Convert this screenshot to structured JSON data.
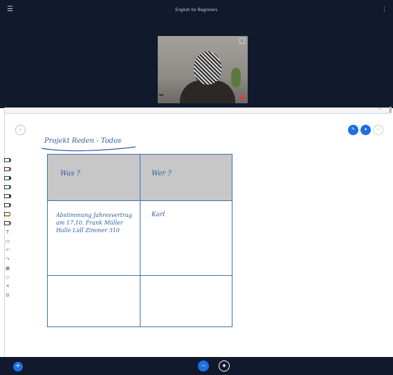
{
  "header": {
    "title": "English for Beginners",
    "menu_icon": "menu-icon",
    "more_icon": "more-icon"
  },
  "webcam": {
    "name_tag": "",
    "icon": "mic-muted-icon"
  },
  "url_bar": {
    "text": "",
    "close": "×"
  },
  "whiteboard": {
    "collapse_icon": "chevron-left-icon",
    "heading": "Projekt Reden - Todos",
    "table": {
      "headers": [
        "Was ?",
        "Wer ?"
      ],
      "rows": [
        [
          "Abstimmung Jahresvertrag am 17.10. Frank Müller Halle Lidl Zimmer 310",
          "Karl"
        ],
        [
          "",
          ""
        ]
      ]
    },
    "right_buttons": [
      {
        "icon": "pen-icon",
        "color": "#1e6fe0"
      },
      {
        "icon": "user-icon",
        "color": "#1e6fe0"
      },
      {
        "icon": "more-options-icon",
        "color": "#ffffff"
      }
    ],
    "tools": [
      {
        "icon": "pen-blue-icon",
        "color": "#2458b8"
      },
      {
        "icon": "pen-red-icon",
        "color": "#d23535"
      },
      {
        "icon": "pen-darkblue-icon",
        "color": "#1b2f80"
      },
      {
        "icon": "pen-green-icon",
        "color": "#2a8a3a"
      },
      {
        "icon": "pen-black-icon",
        "color": "#333333"
      },
      {
        "icon": "pen-purple-icon",
        "color": "#7a3aa0"
      },
      {
        "icon": "highlighter-icon",
        "color": "#e0c020"
      },
      {
        "icon": "marker-icon",
        "color": "#c84a4a"
      },
      {
        "icon": "text-icon",
        "color": "#555555"
      },
      {
        "icon": "eraser-icon",
        "color": "#555555"
      },
      {
        "icon": "undo-icon",
        "color": "#777777"
      },
      {
        "icon": "redo-icon",
        "color": "#777777"
      },
      {
        "icon": "image-icon",
        "color": "#777777"
      },
      {
        "icon": "shapes-icon",
        "color": "#777777"
      },
      {
        "icon": "clear-icon",
        "color": "#777777"
      },
      {
        "icon": "settings-icon",
        "color": "#777777"
      }
    ]
  },
  "footer": {
    "add_icon": "plus-icon",
    "share_icon": "share-screen-icon",
    "mic_icon": "microphone-icon"
  },
  "colors": {
    "header_bg": "#101a2c",
    "accent": "#1e6fe0",
    "ink": "#2e5e9e"
  }
}
